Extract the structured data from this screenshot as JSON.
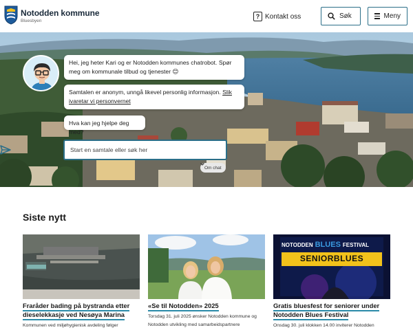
{
  "header": {
    "brand_name": "Notodden kommune",
    "brand_sub": "Bluesbyen",
    "contact_label": "Kontakt oss",
    "search_label": "Søk",
    "menu_label": "Meny"
  },
  "chat": {
    "messages": [
      "Hei, jeg heter Kari og er Notodden kommunes chatrobot. Spør meg om kommunale tilbud og tjenester 😊",
      "Samtalen er anonym, unngå likevel personlig informasjon.",
      "Hva kan jeg hjelpe deg med?"
    ],
    "privacy_link": "Slik ivaretar vi personvernet",
    "input_placeholder": "Start en samtale eller søk her",
    "om_chat_label": "Om chat"
  },
  "news": {
    "title": "Siste nytt",
    "items": [
      {
        "title": "Fraråder bading på bystranda etter dieselekkasje ved Nesøya Marina",
        "desc": "Kommunen ved miljøhygienisk avdeling følger"
      },
      {
        "title": "«Se til Notodden» 2025",
        "desc": "Torsdag 31. juli 2025 ønsker Notodden kommune og Notodden utvikling med samarbeidspartnere"
      },
      {
        "title": "Gratis bluesfest for seniorer under Notodden Blues Festival",
        "desc": "Onsdag 30. juli klokken 14.00 inviterer Notodden",
        "poster_top": "NOTODDEN",
        "poster_blues": "BLUES",
        "poster_festival": "FESTIVAL",
        "poster_headline": "SENIORBLUES"
      }
    ]
  },
  "colors": {
    "accent": "#2a6e88",
    "link_underline": "#2a8aa8",
    "poster_bg": "#0b1133",
    "poster_yellow": "#f2c21b"
  },
  "icons": [
    "shield-logo",
    "question-icon",
    "search-icon",
    "menu-icon",
    "send-icon",
    "chevron-down-icon",
    "chatbot-avatar"
  ]
}
